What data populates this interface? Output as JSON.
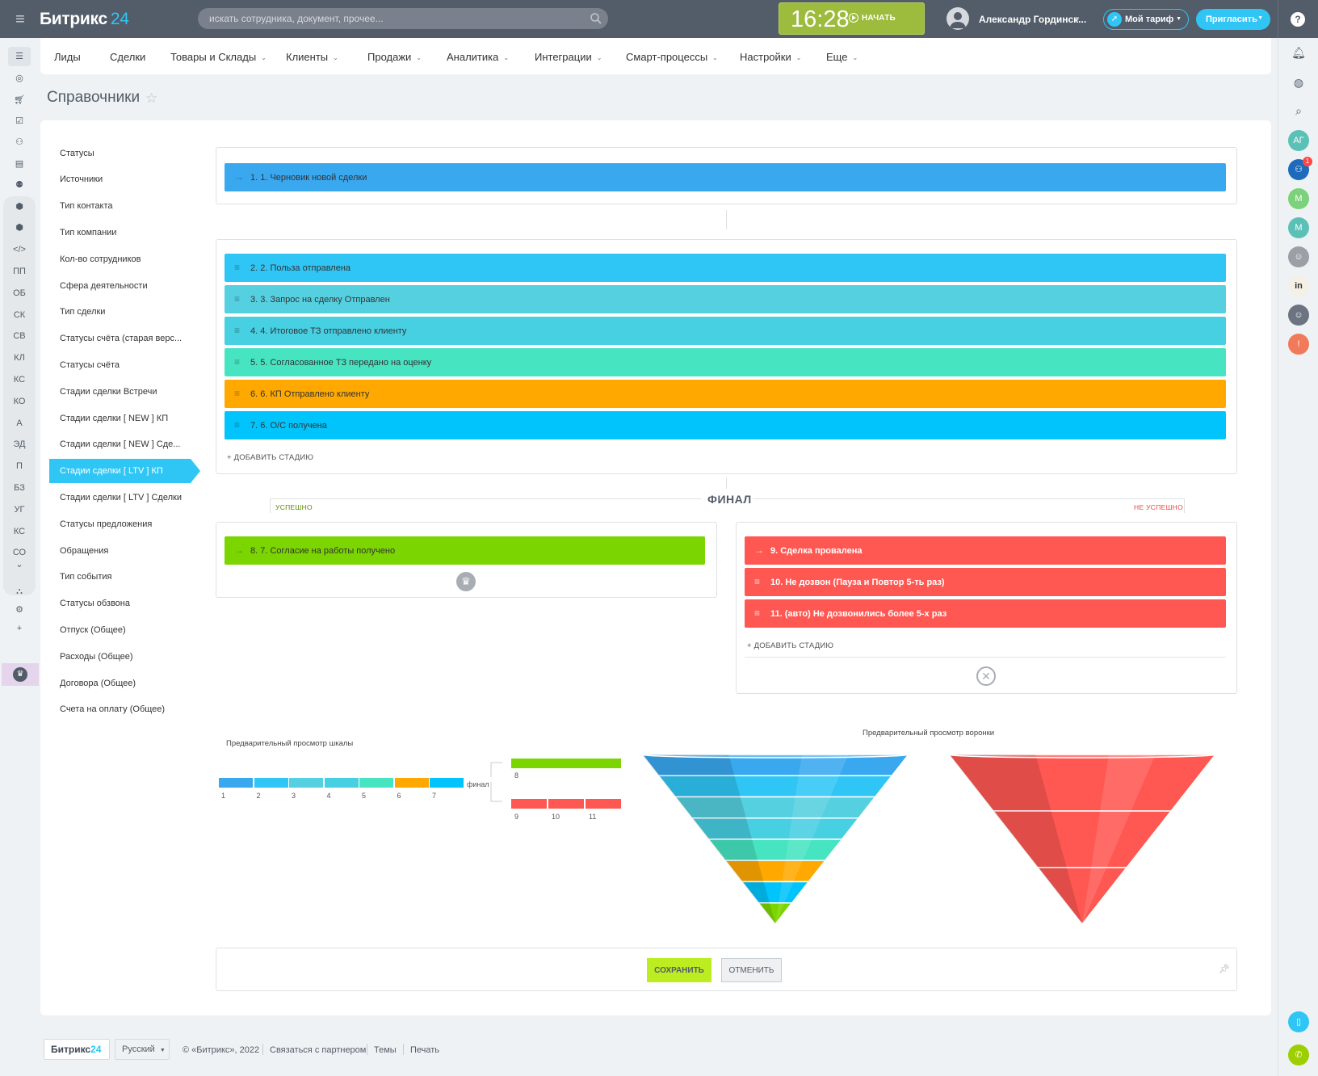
{
  "header": {
    "logo_text": "Битрикс",
    "logo_num": "24",
    "search_placeholder": "искать сотрудника, документ, прочее...",
    "clock_time": "16:28",
    "clock_start": "НАЧАТЬ",
    "user_name": "Александр Гординск...",
    "tariff_label": "Мой тариф",
    "invite_label": "Пригласить",
    "help": "?"
  },
  "left_sidebar": {
    "items": [
      "ПП",
      "ОБ",
      "СК",
      "СВ",
      "КЛ",
      "КС",
      "КО",
      "А",
      "ЭД",
      "П",
      "БЗ",
      "УГ",
      "КС",
      "СО"
    ]
  },
  "right_sidebar": {
    "avatars": [
      {
        "label": "АГ",
        "color": "#5bc1b7"
      },
      {
        "label": "М",
        "color": "#7bd27b"
      },
      {
        "label": "М",
        "color": "#5bc1b7"
      },
      {
        "label": "!",
        "color": "#f07a5a"
      }
    ],
    "notification_count": "1"
  },
  "nav": {
    "items": [
      {
        "label": "Лиды",
        "dropdown": false
      },
      {
        "label": "Сделки",
        "dropdown": false
      },
      {
        "label": "Товары и Склады",
        "dropdown": true
      },
      {
        "label": "Клиенты",
        "dropdown": true
      },
      {
        "label": "Продажи",
        "dropdown": true
      },
      {
        "label": "Аналитика",
        "dropdown": true
      },
      {
        "label": "Интеграции",
        "dropdown": true
      },
      {
        "label": "Смарт-процессы",
        "dropdown": true
      },
      {
        "label": "Настройки",
        "dropdown": true
      },
      {
        "label": "Еще",
        "dropdown": true
      }
    ]
  },
  "page": {
    "title": "Справочники"
  },
  "references": {
    "items": [
      "Статусы",
      "Источники",
      "Тип контакта",
      "Тип компании",
      "Кол-во сотрудников",
      "Сфера деятельности",
      "Тип сделки",
      "Статусы счёта (старая верс...",
      "Статусы счёта",
      "Стадии сделки Встречи",
      "Стадии сделки [ NEW ] КП",
      "Стадии сделки [ NEW ] Сде...",
      "Стадии сделки [ LTV ] КП",
      "Стадии сделки [ LTV ] Сделки",
      "Статусы предложения",
      "Обращения",
      "Тип события",
      "Статусы обзвона",
      "Отпуск (Общее)",
      "Расходы (Общее)",
      "Договора (Общее)",
      "Счета на оплату (Общее)"
    ],
    "active_index": 12
  },
  "stages": {
    "first": {
      "label": "1. 1. Черновик новой сделки",
      "color": "#39a8ef"
    },
    "middle": [
      {
        "label": "2. 2. Польза отправлена",
        "color": "#2fc6f6"
      },
      {
        "label": "3. 3. Запрос на сделку Отправлен",
        "color": "#55d0e0"
      },
      {
        "label": "4. 4. Итоговое ТЗ отправлено клиенту",
        "color": "#47cfe2"
      },
      {
        "label": "5. 5. Согласованное ТЗ передано на оценку",
        "color": "#47e4c2"
      },
      {
        "label": "6. 6. КП Отправлено клиенту",
        "color": "#ffa900"
      },
      {
        "label": "7. 6. О/С получена",
        "color": "#00c4fb"
      }
    ],
    "add_stage": "+ ДОБАВИТЬ СТАДИЮ",
    "final_title": "ФИНАЛ",
    "success_label": "УСПЕШНО",
    "fail_label": "НЕ УСПЕШНО",
    "success": {
      "label": "8. 7. Согласие на работы получено",
      "color": "#7bd500"
    },
    "fail": [
      {
        "label": "9. Сделка провалена",
        "color": "#ff5752"
      },
      {
        "label": "10. Не дозвон (Пауза и Повтор 5-ть раз)",
        "color": "#ff5752"
      },
      {
        "label": "11. (авто) Не дозвонились более 5-х раз",
        "color": "#ff5752"
      }
    ],
    "add_stage_fail": "+ ДОБАВИТЬ СТАДИЮ"
  },
  "preview": {
    "scale_title": "Предварительный просмотр шкалы",
    "funnel_title": "Предварительный просмотр воронки",
    "scale_labels": [
      "1",
      "2",
      "3",
      "4",
      "5",
      "6",
      "7"
    ],
    "final_label": "финал",
    "success_labels": [
      "8"
    ],
    "fail_labels": [
      "9",
      "10",
      "11"
    ]
  },
  "actions": {
    "save": "СОХРАНИТЬ",
    "cancel": "ОТМЕНИТЬ"
  },
  "footer": {
    "logo": "Битрикс",
    "logo_num": "24",
    "lang": "Русский",
    "copyright": "© «Битрикс», 2022",
    "partner": "Связаться с партнером",
    "themes": "Темы",
    "print": "Печать"
  }
}
